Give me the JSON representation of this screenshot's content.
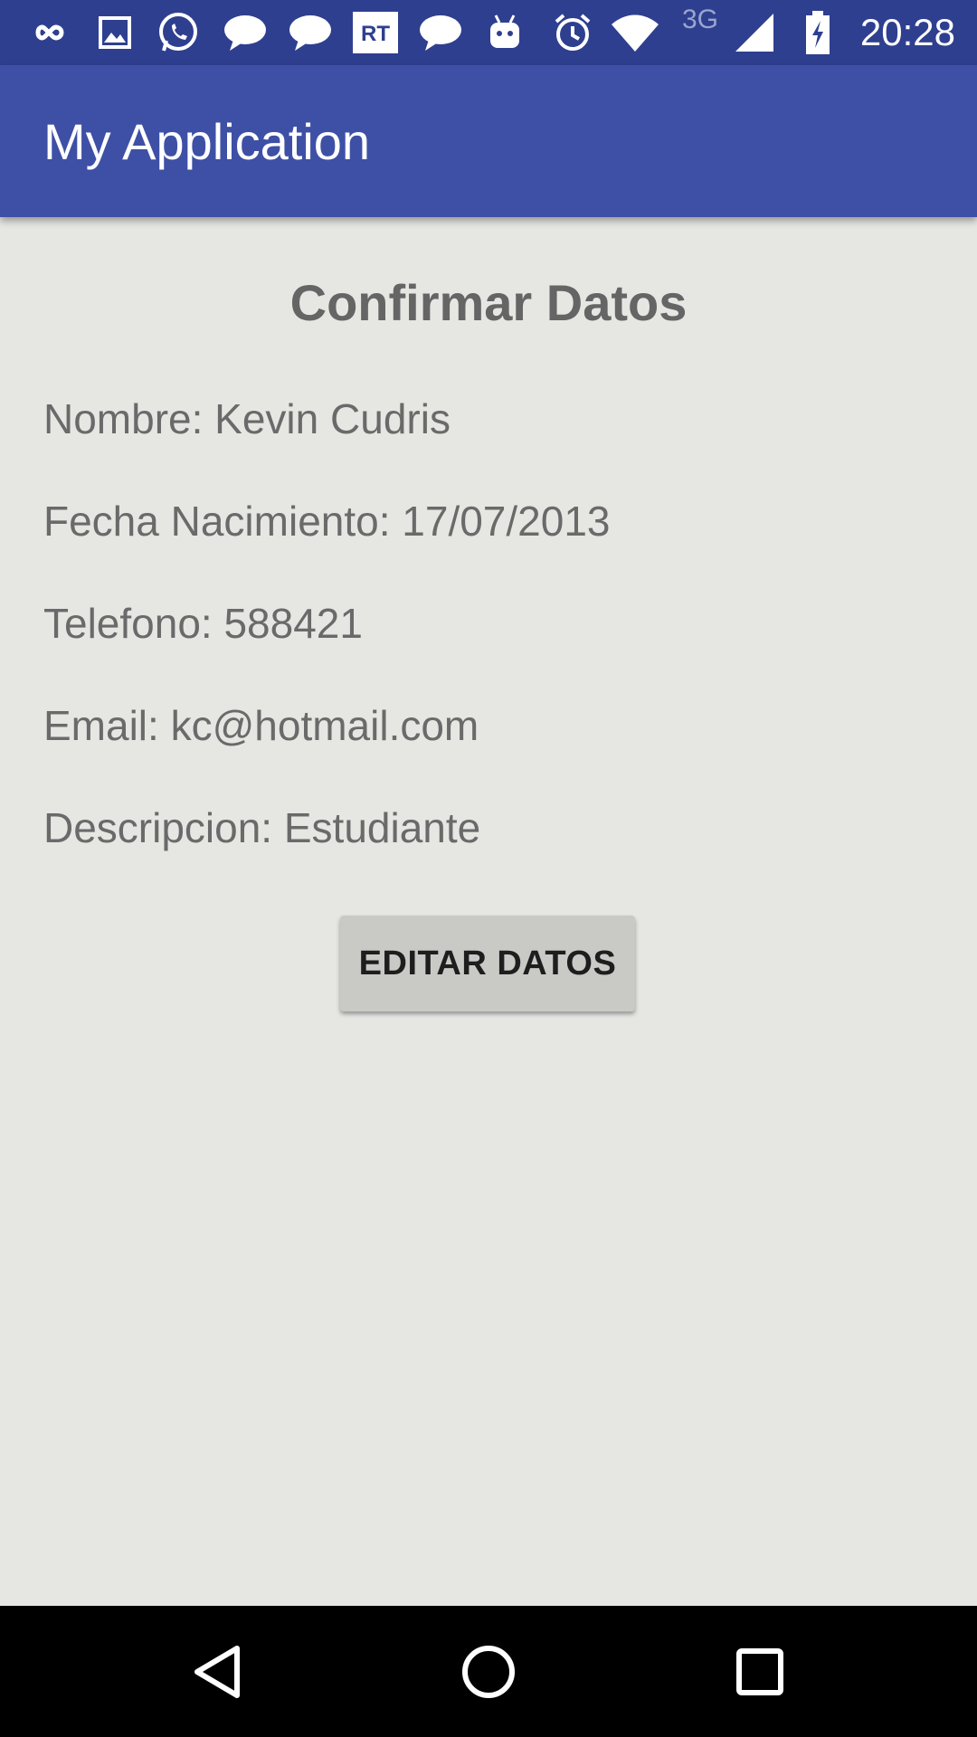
{
  "status_bar": {
    "time": "20:28",
    "network_label": "3G",
    "icons": [
      "infinity-icon",
      "image-icon",
      "whatsapp-icon",
      "chat-bubble-icon",
      "chat-bubble-icon",
      "rt-news-icon",
      "chat-bubble-icon",
      "android-icon",
      "alarm-icon",
      "wifi-icon",
      "signal-icon",
      "battery-charging-icon"
    ]
  },
  "app_bar": {
    "title": "My Application",
    "color": "#3e50a5"
  },
  "form": {
    "heading": "Confirmar Datos",
    "fields": [
      "Nombre: Kevin Cudris",
      "Fecha Nacimiento: 17/07/2013",
      "Telefono: 588421",
      "Email: kc@hotmail.com",
      "Descripcion: Estudiante"
    ],
    "edit_button_label": "EDITAR DATOS"
  },
  "nav_bar": {
    "buttons": [
      "back-icon",
      "home-icon",
      "recents-icon"
    ]
  }
}
